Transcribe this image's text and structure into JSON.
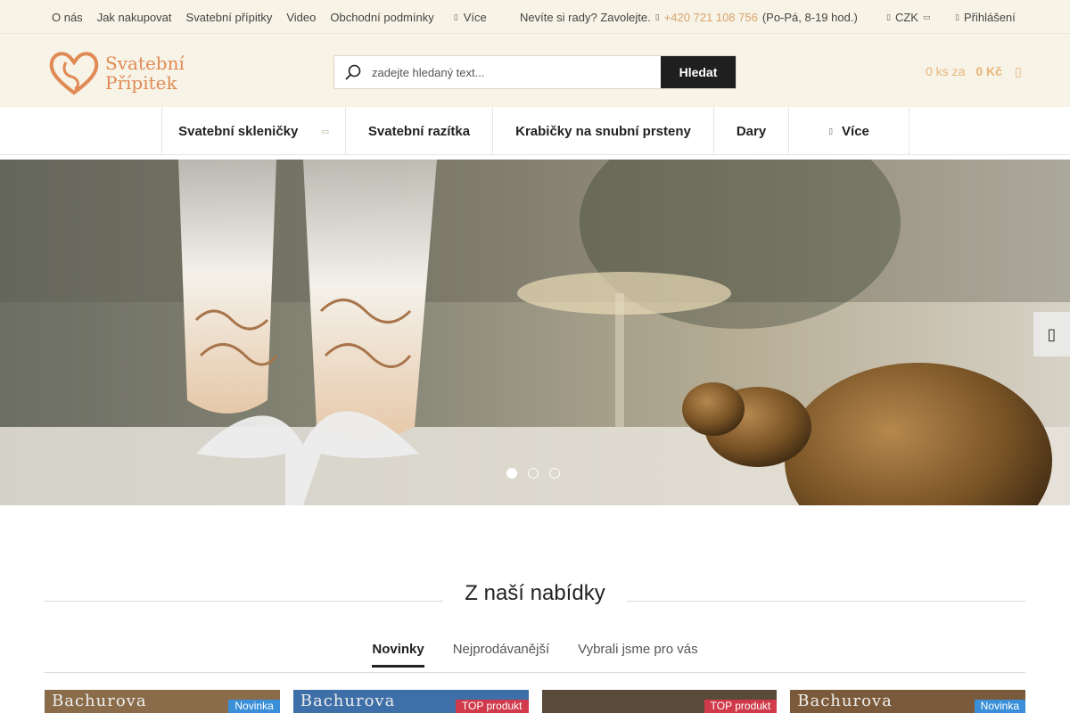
{
  "top_nav": {
    "links": [
      "O nás",
      "Jak nakupovat",
      "Svatební přípitky",
      "Video",
      "Obchodní podmínky"
    ],
    "more_label": "Více"
  },
  "help": {
    "text": "Nevíte si rady? Zavolejte.",
    "phone": "+420 721 108 756",
    "hours": "(Po-Pá, 8-19 hod.)"
  },
  "currency": {
    "label": "CZK"
  },
  "login": {
    "label": "Přihlášení"
  },
  "logo": {
    "line1": "Svatební",
    "line2": "Přípitek"
  },
  "search": {
    "placeholder": "zadejte hledaný text...",
    "button_label": "Hledat"
  },
  "cart": {
    "count_text": "0 ks za",
    "price": "0 Kč"
  },
  "main_menu": [
    {
      "label": "Svatební skleničky",
      "has_dropdown": true
    },
    {
      "label": "Svatební razítka",
      "has_dropdown": false
    },
    {
      "label": "Krabičky na snubní prsteny",
      "has_dropdown": false
    },
    {
      "label": "Dary",
      "has_dropdown": false
    },
    {
      "label": "Více",
      "has_dropdown": false
    }
  ],
  "hero": {
    "slides": 3,
    "active_slide": 1
  },
  "offer": {
    "title": "Z naší nabídky",
    "tabs": [
      {
        "label": "Novinky",
        "active": true
      },
      {
        "label": "Nejprodávanější",
        "active": false
      },
      {
        "label": "Vybrali jsme pro vás",
        "active": false
      }
    ],
    "products": [
      {
        "image_text": "Bachurova",
        "badge": "Novinka",
        "badge_type": "new"
      },
      {
        "image_text": "Bachurova",
        "badge": "TOP produkt",
        "badge_type": "top"
      },
      {
        "image_text": "",
        "badge": "TOP produkt",
        "badge_type": "top"
      },
      {
        "image_text": "Bachurova",
        "badge": "Novinka",
        "badge_type": "new"
      }
    ]
  },
  "colors": {
    "header_bg": "#f7f3e6",
    "accent": "#e08a55",
    "cart_text": "#e8b57a",
    "badge_new": "#3a8fd8",
    "badge_top": "#d03a4a"
  }
}
